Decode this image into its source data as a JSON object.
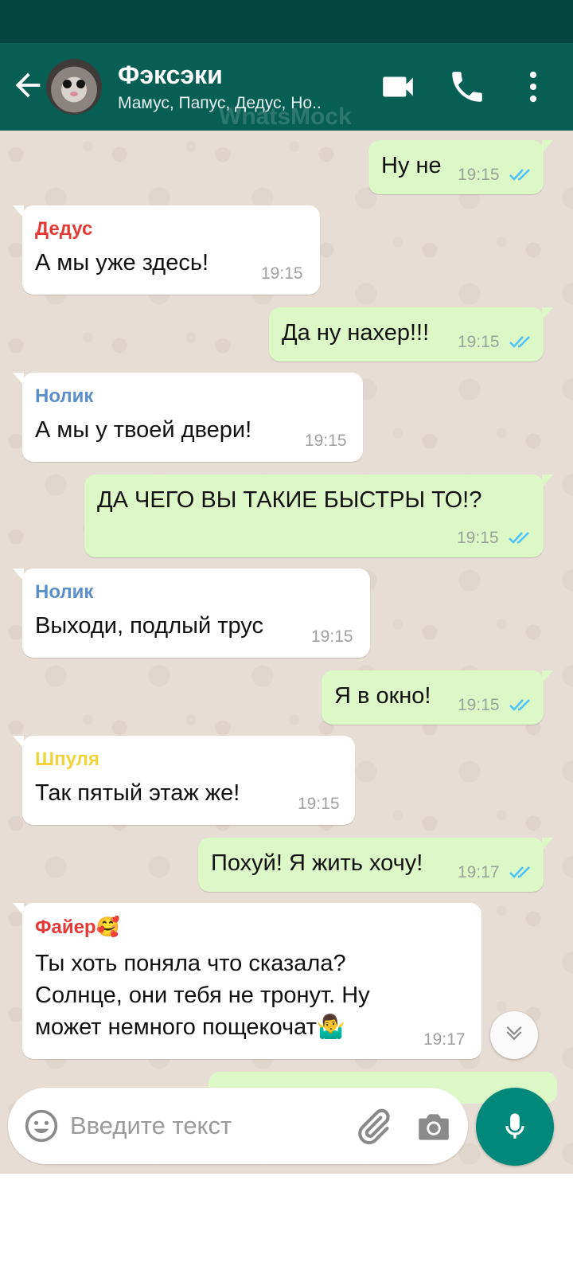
{
  "header": {
    "title": "Фэксэки",
    "subtitle": "Мамус, Папус, Дедус, Но..",
    "watermark": "WhatsMock",
    "icons": [
      "back-arrow-icon",
      "video-call-icon",
      "phone-icon",
      "more-vert-icon"
    ],
    "colors": {
      "bar": "#075e54",
      "status": "#054640"
    }
  },
  "messages": [
    {
      "dir": "out",
      "text": "Ну не",
      "time": "19:15",
      "status": "read"
    },
    {
      "dir": "in",
      "sender": "Дедус",
      "sender_color": "#e53935",
      "text": "А мы уже здесь!",
      "time": "19:15"
    },
    {
      "dir": "out",
      "text": "Да ну нахер!!!",
      "time": "19:15",
      "status": "read"
    },
    {
      "dir": "in",
      "sender": "Нолик",
      "sender_color": "#5b8fc9",
      "text": "А мы у твоей двери!",
      "time": "19:15"
    },
    {
      "dir": "out",
      "text": "ДА ЧЕГО ВЫ ТАКИЕ БЫСТРЫ ТО!?",
      "time": "19:15",
      "status": "read"
    },
    {
      "dir": "in",
      "sender": "Нолик",
      "sender_color": "#5b8fc9",
      "text": "Выходи, подлый трус",
      "time": "19:15"
    },
    {
      "dir": "out",
      "text": "Я в окно!",
      "time": "19:15",
      "status": "read"
    },
    {
      "dir": "in",
      "sender": "Шпуля",
      "sender_color": "#f0d43a",
      "text": "Так пятый этаж же!",
      "time": "19:15"
    },
    {
      "dir": "out",
      "text": "Похуй! Я жить хочу!",
      "time": "19:17",
      "status": "read"
    },
    {
      "dir": "in",
      "sender": "Файер🥰",
      "sender_color": "#e53935",
      "text_lines": [
        "Ты хоть поняла что сказала?",
        "Солнце, они тебя не тронут. Ну",
        "может немного пощекочат🤷‍♂️"
      ],
      "time": "19:17"
    }
  ],
  "composer": {
    "placeholder": "Введите текст",
    "icons": [
      "emoji-icon",
      "attach-icon",
      "camera-icon",
      "mic-icon"
    ],
    "scroll_icon": "chevron-down-icon"
  },
  "colors": {
    "outgoing": "#dcf8c6",
    "incoming": "#ffffff",
    "tick": "#4fc3f7",
    "fab": "#00897b"
  }
}
